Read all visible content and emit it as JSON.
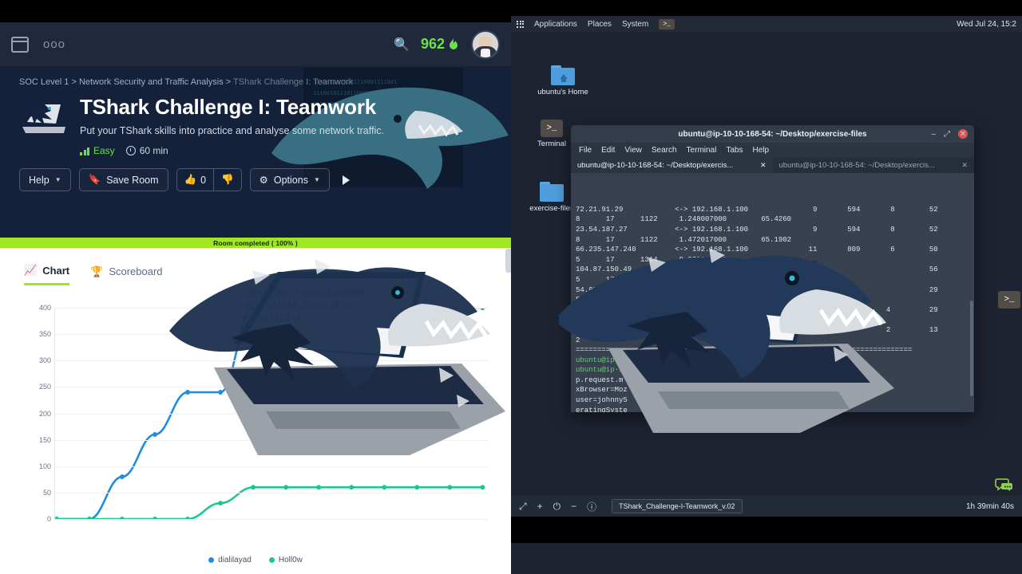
{
  "tryhackme": {
    "nav": {
      "menu_icon": "window-icon",
      "more_icon": "ooo",
      "search_icon": "search-icon",
      "streak_count": "962",
      "streak_icon": "flame-icon",
      "avatar_label": "user-avatar"
    },
    "breadcrumb": {
      "level1": "SOC Level 1",
      "sep1": ">",
      "level2": "Network Security and Traffic Analysis",
      "sep2": ">",
      "level3": "TShark Challenge I: Teamwork"
    },
    "hero": {
      "title": "TShark Challenge I: Teamwork",
      "subtitle": "Put your TShark skills into practice and analyse some network traffic.",
      "difficulty": "Easy",
      "duration": "60 min"
    },
    "buttons": {
      "help": "Help",
      "save_room": "Save Room",
      "upvote_count": "0",
      "options": "Options"
    },
    "progress_bar": "Room completed ( 100% )",
    "tabs": [
      {
        "label": "Chart",
        "icon": "chart-icon",
        "active": true
      },
      {
        "label": "Scoreboard",
        "icon": "trophy-icon",
        "active": false
      }
    ]
  },
  "chart_data": {
    "type": "line",
    "title": "",
    "xlabel": "",
    "ylabel": "",
    "ylim": [
      0,
      400
    ],
    "yticks": [
      0,
      50,
      100,
      150,
      200,
      250,
      300,
      350,
      400
    ],
    "grid": true,
    "legend_position": "bottom",
    "x": [
      1,
      2,
      3,
      4,
      5,
      6,
      7,
      8,
      9,
      10,
      11,
      12,
      13,
      14
    ],
    "series": [
      {
        "name": "dialilayad",
        "color": "#1f8ce0",
        "values": [
          0,
          0,
          80,
          160,
          240,
          240,
          400,
          400,
          400,
          400,
          400,
          400,
          400,
          400
        ]
      },
      {
        "name": "Holl0w",
        "color": "#17c98a",
        "values": [
          0,
          0,
          0,
          0,
          0,
          30,
          60,
          60,
          60,
          60,
          60,
          60,
          60,
          60
        ]
      }
    ]
  },
  "ubuntu": {
    "panel": {
      "applications": "Applications",
      "places": "Places",
      "system": "System",
      "terminal_icon": "terminal-icon",
      "clock": "Wed Jul 24, 15:2"
    },
    "desktop_icons": [
      {
        "label": "Terminal",
        "icon": "terminal-icon"
      },
      {
        "label": "exercise-files",
        "icon": "folder-icon"
      },
      {
        "label": "ubuntu's Home",
        "icon": "home-folder-icon"
      }
    ],
    "terminal_window": {
      "title": "ubuntu@ip-10-10-168-54: ~/Desktop/exercise-files",
      "menu": [
        "File",
        "Edit",
        "View",
        "Search",
        "Terminal",
        "Tabs",
        "Help"
      ],
      "minimize_icon": "minimize-icon",
      "maximize_icon": "maximize-icon",
      "close_icon": "close-icon",
      "tabs": [
        {
          "label": "ubuntu@ip-10-10-168-54: ~/Desktop/exercis...",
          "active": true,
          "close": "✕"
        },
        {
          "label": "ubuntu@ip-10-10-168-54: ~/Desktop/exercis...",
          "active": false,
          "close": "✕"
        }
      ],
      "content_lines": [
        "72.21.91.29            <-> 192.168.1.100               9       594       8        52",
        "8      17      1122     1.248007000        65.4260",
        "23.54.187.27           <-> 192.168.1.100               9       594       8        52",
        "8      17      1122     1.472017000        65.1902",
        "66.235.147.240         <-> 192.168.1.100              11       809       6        50",
        "5      17      1314     9.879217000       122.4240",
        "104.87.150.49          <-> 192.168.1.100              11                          56",
        "5      17      1482    11.879996000          47",
        "54.87.193.254          <-> 192.168.1.100                                          29",
        "5       9       625     1.248019000",
        "52.1.131.                                                               4         29",
        "5       8",
        "54.164.88.                                                              2         13",
        "2       3",
        "=============================================================================="
      ],
      "prompt_lines": [
        {
          "text": "ubuntu@ip-1",
          "green": true
        },
        {
          "text": "ubuntu@ip-1                                  eamwork.pcap -Y \"htt",
          "green": true
        },
        {
          "text": "p.request.m",
          "green": false
        },
        {
          "text": "xBrowser=Moz               xPlo     esktop+Platform",
          "green": false
        },
        {
          "text": "user=johnny5              owser=Moz.   +FireFox+v43&xOp",
          "green": false
        },
        {
          "text": "eratingSyste              eZone=Mon+Ap 17+2017+22%3A00",
          "green": false
        },
        {
          "text": "%3A35+GMT-040             80%3B rowser+inner%3A+1920x",
          "green": false
        },
        {
          "text": "762%3B+Browse",
          "green": false
        },
        {
          "text": "ubuntu@ip-10-",
          "green": true
        }
      ]
    },
    "taskbar": {
      "fullscreen_icon": "expand-icon",
      "plus_icon": "plus-icon",
      "power_icon": "power-icon",
      "minus_icon": "minus-icon",
      "info_icon": "info-icon",
      "window_name": "TShark_Challenge-I-Teamwork_v.02",
      "timer": "1h 39min 40s",
      "chat_icon": "chat-bubble-icon"
    }
  }
}
